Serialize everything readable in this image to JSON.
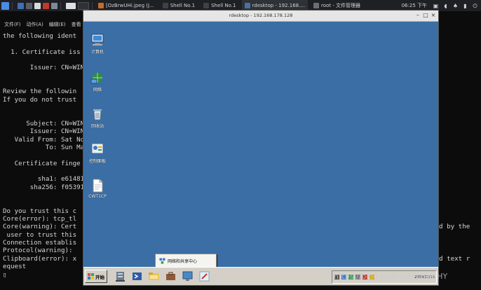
{
  "taskbar": {
    "windows": [
      {
        "label": "[OzBrwUHi.jpeg (J...",
        "active": false
      },
      {
        "label": "Shell No.1",
        "active": false
      },
      {
        "label": "Shell No.1",
        "active": false
      },
      {
        "label": "rdesktop - 192.168....",
        "active": true
      },
      {
        "label": "root - 文件管理器",
        "active": false
      }
    ],
    "clock": "06:25 下午"
  },
  "terminal": {
    "menu": [
      "文件(F)",
      "动作(A)",
      "编辑(E)",
      "查看"
    ],
    "lines": [
      "the following ident",
      "",
      "  1. Certificate iss",
      "",
      "       Issuer: CN=WIN",
      "",
      "",
      "Review the followin",
      "If you do not trust",
      "",
      "",
      "      Subject: CN=WIN",
      "       Issuer: CN=WIN",
      "   Valid From: Sat No",
      "           To: Sun Ma",
      "",
      "   Certificate finge",
      "",
      "         sha1: e61481",
      "       sha256: f05391",
      "",
      "",
      "Do you trust this c",
      "Core(error): tcp_tl",
      "Core(warning): Cert",
      " user to trust this",
      "Connection establis",
      "Protocol(warning): ",
      "Clipboard(error): x",
      "equest",
      "▯"
    ],
    "right_fragments": [
      {
        "text": "d by the",
        "line": 24
      },
      {
        "text": "d text r",
        "line": 28
      }
    ]
  },
  "rdesktop": {
    "title": "rdesktop - 192.168.178.128",
    "desktop_icons": [
      {
        "label": "计算机",
        "icon": "computer-icon"
      },
      {
        "label": "网络",
        "icon": "network-icon"
      },
      {
        "label": "回收站",
        "icon": "recycle-bin-icon"
      },
      {
        "label": "控制面板",
        "icon": "control-panel-icon"
      },
      {
        "label": "CWT1CP",
        "icon": "document-icon"
      }
    ],
    "popup": {
      "label": "网络和共享中心"
    },
    "start_label": "开始",
    "tray_time": "2009/11/15"
  },
  "watermark": "https://blog.csdn.net/JasonHY",
  "colors": {
    "desktop": "#3a6ea5",
    "terminal_bg": "#0c0c0c",
    "taskbar_bg": "#1e2024"
  }
}
